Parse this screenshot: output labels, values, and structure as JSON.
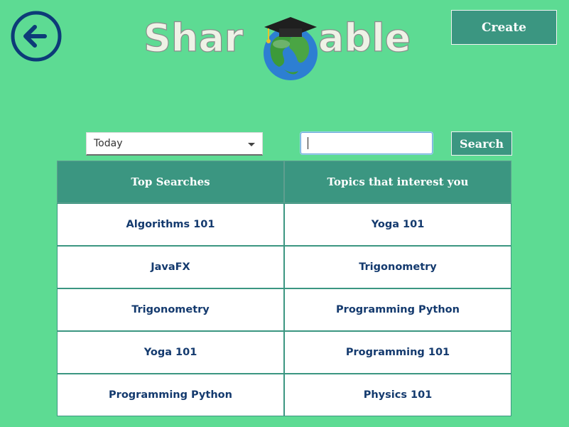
{
  "header": {
    "back_icon": "arrow-left-circle-icon",
    "logo_text_left": "Shar",
    "logo_text_right": "able",
    "logo_icon": "graduation-globe-icon",
    "create_label": "Create"
  },
  "filters": {
    "period_selected": "Today",
    "search_value": "",
    "search_label": "Search"
  },
  "table": {
    "headers": [
      "Top Searches",
      "Topics that interest you"
    ],
    "top_searches": [
      "Algorithms 101",
      "JavaFX",
      "Trigonometry",
      "Yoga 101",
      "Programming Python"
    ],
    "topics": [
      "Yoga 101",
      "Trigonometry",
      "Programming Python",
      "Programming 101",
      "Physics 101"
    ]
  },
  "colors": {
    "background": "#5ddb93",
    "accent": "#3b9681",
    "text_navy": "#143a6e"
  }
}
